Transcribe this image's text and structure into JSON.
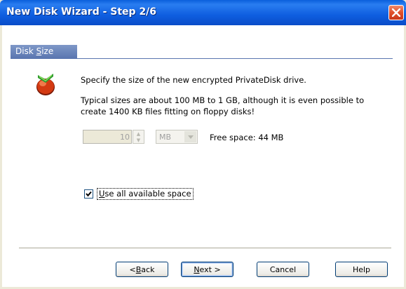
{
  "window": {
    "title": "New Disk Wizard - Step 2/6"
  },
  "section": {
    "title_pre": "Disk ",
    "title_access": "S",
    "title_post": "ize"
  },
  "description": {
    "line1": "Specify the size of the new encrypted PrivateDisk drive.",
    "line2": "Typical sizes are about 100 MB to 1 GB, although it is even possible to",
    "line3": "create 1400 KB files fitting on floppy disks!"
  },
  "size": {
    "value": "10",
    "unit": "MB",
    "free_space": "Free space: 44 MB"
  },
  "use_all": {
    "checked": true,
    "label_access": "U",
    "label_rest": "se all available space"
  },
  "buttons": {
    "back_pre": "< ",
    "back_access": "B",
    "back_rest": "ack",
    "next_access": "N",
    "next_rest": "ext >",
    "cancel": "Cancel",
    "help": "Help"
  }
}
